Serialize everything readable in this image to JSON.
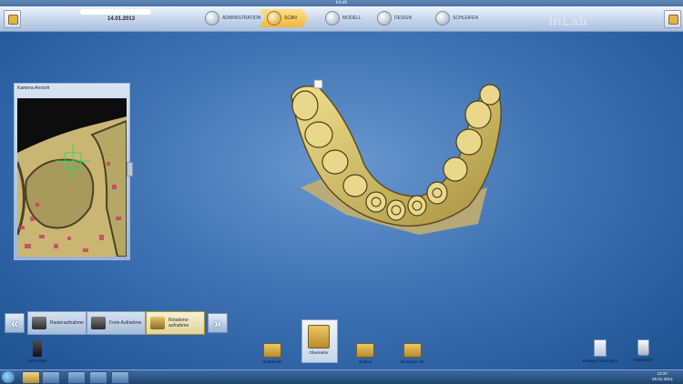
{
  "window": {
    "title": "inLab"
  },
  "header": {
    "date": "14.01.2013",
    "brand": "inLab",
    "stages": [
      {
        "label": "ADMINISTRATION",
        "icon": "administration-icon"
      },
      {
        "label": "SCAN",
        "icon": "scan-icon",
        "active": true
      },
      {
        "label": "MODELL",
        "icon": "model-icon"
      },
      {
        "label": "DESIGN",
        "icon": "design-icon"
      },
      {
        "label": "SCHLEIFEN",
        "icon": "milling-icon"
      }
    ]
  },
  "camera_panel": {
    "title": "Kamera-Ansicht"
  },
  "scan_modes": [
    {
      "label": "Rasteraufnahme"
    },
    {
      "label": "Freie Aufnahme"
    },
    {
      "label": "Rotations-aufnahme",
      "active": true
    }
  ],
  "left_tool": {
    "label": "inEos Blue"
  },
  "catalog": [
    {
      "label": "Unterkiefer"
    },
    {
      "label": "Oberkiefer",
      "selected": true
    },
    {
      "label": "Bukkal"
    },
    {
      "label": "BioKopie UK"
    }
  ],
  "right_tools": [
    {
      "label": "Katalog hinzufügen"
    },
    {
      "label": "Papierkorb"
    }
  ],
  "taskbar": {
    "time": "13:37",
    "date": "29.01.2013"
  },
  "colors": {
    "accent": "#f0b73c",
    "background": "#3f73b3",
    "scan_model": "#d9c36a"
  }
}
